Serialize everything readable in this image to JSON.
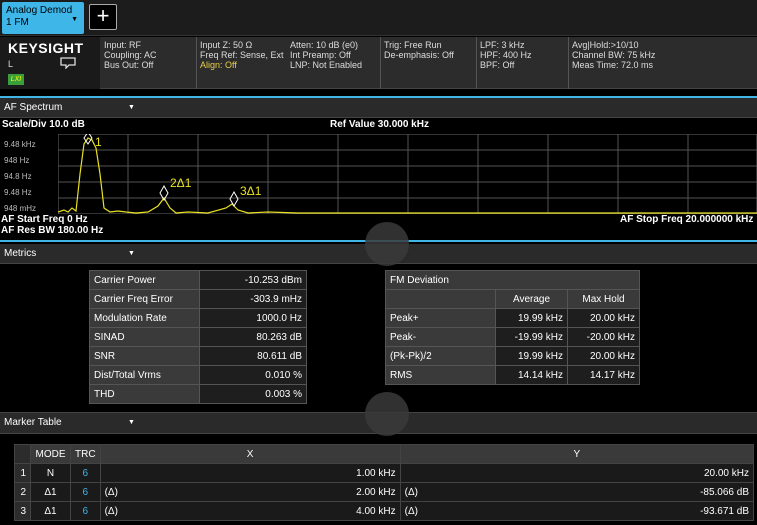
{
  "window": {
    "active_tab": "Analog Demod 1 FM",
    "add_tab_symbol": "+"
  },
  "brand": {
    "name": "KEYSIGHT",
    "line2": "L",
    "badge": "LXI"
  },
  "settings": {
    "input": [
      "Input: RF",
      "Coupling: AC",
      "Bus Out: Off"
    ],
    "impedance": [
      "Input Z: 50 Ω",
      "Freq Ref: Sense, Ext",
      "Align: Off"
    ],
    "atten": [
      "Atten: 10 dB (e0)",
      "Int Preamp: Off",
      "LNP: Not Enabled"
    ],
    "trig": [
      "Trig: Free Run",
      "De-emphasis: Off"
    ],
    "filters": [
      "LPF: 3 kHz",
      "HPF: 400 Hz",
      "BPF: Off"
    ],
    "avg": [
      "Avg|Hold:>10/10",
      "Channel BW: 75 kHz",
      "Meas Time: 72.0 ms"
    ]
  },
  "spectrum": {
    "panel_title": "AF Spectrum",
    "scale": "Scale/Div 10.0 dB",
    "ref": "Ref Value 30.000 kHz",
    "y_ticks": [
      "9.48 kHz",
      "948 Hz",
      "94.8 Hz",
      "9.48 Hz",
      "948 mHz"
    ],
    "start": "AF Start Freq 0 Hz",
    "res_bw": "AF Res BW 180.00 Hz",
    "stop": "AF Stop Freq 20.000000 kHz",
    "markers": [
      "1",
      "2Δ1",
      "3Δ1"
    ],
    "trace_color": "#e8e020"
  },
  "metrics": {
    "panel_title": "Metrics",
    "rows": [
      {
        "label": "Carrier Power",
        "value": "-10.253 dBm"
      },
      {
        "label": "Carrier Freq Error",
        "value": "-303.9 mHz"
      },
      {
        "label": "Modulation Rate",
        "value": "1000.0 Hz"
      },
      {
        "label": "SINAD",
        "value": "80.263 dB"
      },
      {
        "label": "SNR",
        "value": "80.611 dB"
      },
      {
        "label": "Dist/Total Vrms",
        "value": "0.010 %"
      },
      {
        "label": "THD",
        "value": "0.003 %"
      }
    ],
    "fm": {
      "title": "FM Deviation",
      "headers": [
        "Average",
        "Max Hold"
      ],
      "rows": [
        {
          "label": "Peak+",
          "avg": "19.99 kHz",
          "max": "20.00 kHz"
        },
        {
          "label": "Peak-",
          "avg": "-19.99 kHz",
          "max": "-20.00 kHz"
        },
        {
          "label": "(Pk-Pk)/2",
          "avg": "19.99 kHz",
          "max": "20.00 kHz"
        },
        {
          "label": "RMS",
          "avg": "14.14 kHz",
          "max": "14.17 kHz"
        }
      ]
    }
  },
  "marker_table": {
    "panel_title": "Marker Table",
    "headers": [
      "MODE",
      "TRC",
      "X",
      "Y"
    ],
    "rows": [
      {
        "idx": "1",
        "mode": "N",
        "trc": "6",
        "xref": "",
        "x": "1.00 kHz",
        "yref": "",
        "y": "20.00 kHz"
      },
      {
        "idx": "2",
        "mode": "Δ1",
        "trc": "6",
        "xref": "(Δ)",
        "x": "2.00 kHz",
        "yref": "(Δ)",
        "y": "-85.066 dB"
      },
      {
        "idx": "3",
        "mode": "Δ1",
        "trc": "6",
        "xref": "(Δ)",
        "x": "4.00 kHz",
        "yref": "(Δ)",
        "y": "-93.671 dB"
      }
    ]
  }
}
